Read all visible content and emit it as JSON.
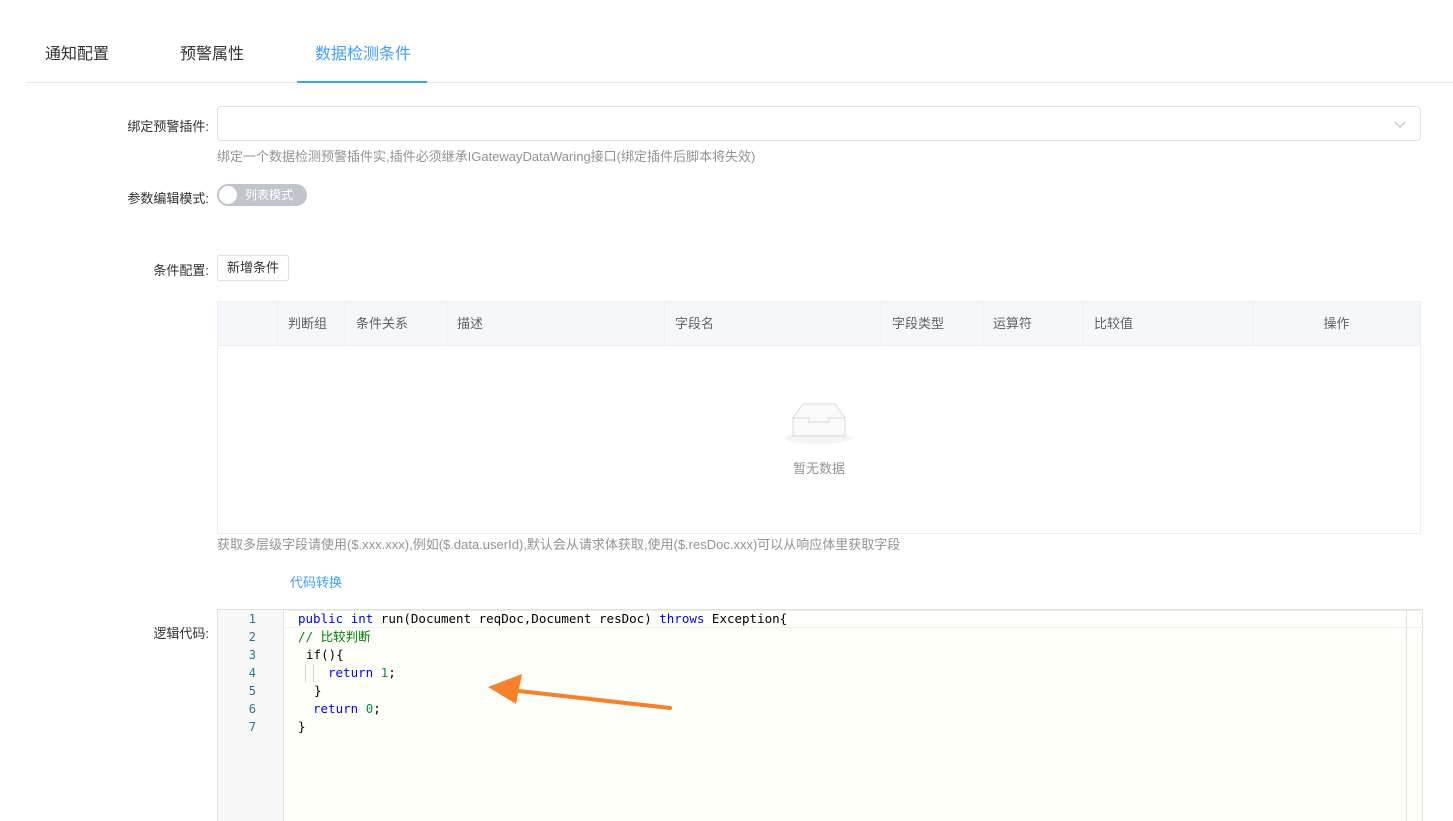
{
  "tabs": [
    {
      "label": "通知配置"
    },
    {
      "label": "预警属性"
    },
    {
      "label": "数据检测条件"
    }
  ],
  "form": {
    "plugin_label": "绑定预警插件:",
    "plugin_hint": "绑定一个数据检测预警插件实,插件必须继承IGatewayDataWaring接口(绑定插件后脚本将失效)",
    "mode_label": "参数编辑模式:",
    "mode_switch_text": "列表模式",
    "condition_label": "条件配置:",
    "add_condition_button": "新增条件",
    "table": {
      "columns": [
        "",
        "判断组",
        "条件关系",
        "描述",
        "字段名",
        "字段类型",
        "运算符",
        "比较值",
        "操作"
      ],
      "empty_text": "暂无数据"
    },
    "table_hint": "获取多层级字段请使用($.xxx.xxx),例如($.data.userId),默认会从请求体获取,使用($.resDoc.xxx)可以从响应体里获取字段",
    "convert_link": "代码转换",
    "code_label": "逻辑代码:",
    "code_lines": [
      {
        "n": "1",
        "text": ""
      },
      {
        "n": "2",
        "text": ""
      },
      {
        "n": "3",
        "text": ""
      },
      {
        "n": "4",
        "text": ""
      },
      {
        "n": "5",
        "text": ""
      },
      {
        "n": "6",
        "text": ""
      },
      {
        "n": "7",
        "text": ""
      }
    ],
    "code": {
      "l1_a": "public",
      "l1_b": " ",
      "l1_c": "int",
      "l1_d": " run(Document reqDoc,Document resDoc) ",
      "l1_e": "throws",
      "l1_f": " Exception{",
      "l2": "// 比较判断",
      "l3_a": "if",
      "l3_b": "(){",
      "l4_a": "return",
      "l4_b": " ",
      "l4_c": "1",
      "l4_d": ";",
      "l5": "}",
      "l6_a": "return",
      "l6_b": " ",
      "l6_c": "0",
      "l6_d": ";",
      "l7": "}"
    }
  },
  "colors": {
    "accent": "#409eff",
    "arrow": "#f5822a"
  }
}
